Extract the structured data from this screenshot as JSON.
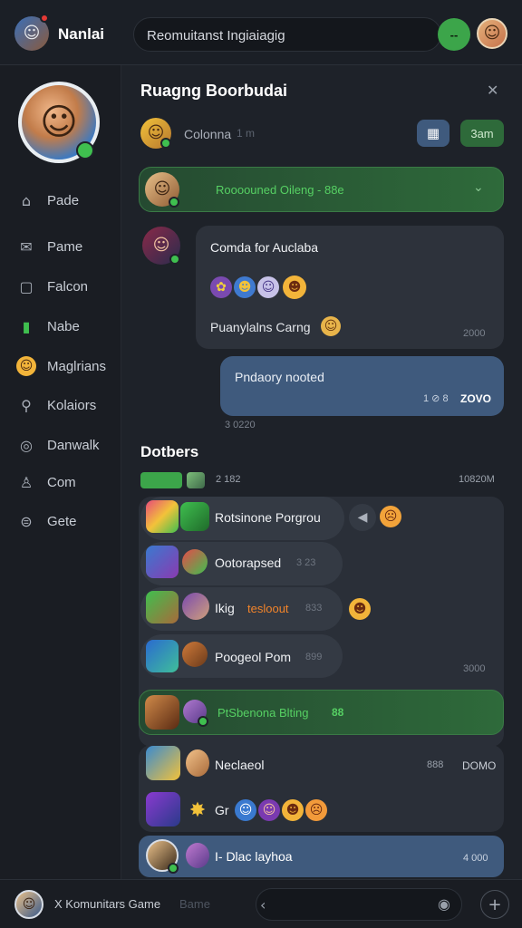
{
  "topbar": {
    "app_name": "Nanlai",
    "search_text": "Reomuitanst Ingiaiagig",
    "status_button": "--"
  },
  "sidebar": {
    "items": [
      {
        "label": "Pade",
        "icon": "home-icon"
      },
      {
        "label": "Pame",
        "icon": "mail-icon"
      },
      {
        "label": "Falcon",
        "icon": "square-icon"
      },
      {
        "label": "Nabe",
        "icon": "chart-icon"
      },
      {
        "label": "Maglrians",
        "icon": "profile-icon"
      },
      {
        "label": "Kolaiors",
        "icon": "search-icon"
      },
      {
        "label": "Danwalk",
        "icon": "globe-icon"
      },
      {
        "label": "Com",
        "icon": "user-icon"
      },
      {
        "label": "Gete",
        "icon": "settings-icon"
      }
    ]
  },
  "main": {
    "title": "Ruagng Boorbudai",
    "close_icon": "close-icon",
    "header_user": "Colonna",
    "header_user_meta": "1 m",
    "calendar_icon": "calendar-icon",
    "action_button": "3am",
    "banner": "Roooouned Oileng - 88e",
    "message1": {
      "title": "Comda for Auclaba",
      "line": "Puanylalns Carng",
      "time": "2000"
    },
    "message2": {
      "text": "Pndaory nooted",
      "meta": "1 ⊘ 8",
      "status": "ZOVO",
      "time": "3 0220"
    },
    "section_title": "Dotbers",
    "section_count": "2 182",
    "section_time": "10820M",
    "list": [
      {
        "name": "Rotsinone Porgrou",
        "meta": ""
      },
      {
        "name": "Ootorapsed",
        "meta": "3 23"
      },
      {
        "name": "Ikig",
        "highlight": "tesloout",
        "meta": "833"
      },
      {
        "name": "Poogeol Pom",
        "meta": "899"
      }
    ],
    "list_time": "3000",
    "banner2": "PtSbenona Blting",
    "banner2_badge": "88",
    "row1": {
      "name": "Neclaeol",
      "meta": "888",
      "status": "DOMO"
    },
    "row2": {
      "name": "Gr"
    },
    "highlight_row": {
      "name": "I- Dlac layhoa",
      "time": "4 000"
    }
  },
  "bottombar": {
    "label": "X Komunitars Game",
    "label_sub": "Bame",
    "back_icon": "chevron-left-icon",
    "mic_icon": "microphone-icon",
    "add_icon": "plus-icon"
  },
  "colors": {
    "accent_green": "#3a9b45",
    "accent_blue": "#3f5a7d",
    "panel": "#2a2f38"
  }
}
